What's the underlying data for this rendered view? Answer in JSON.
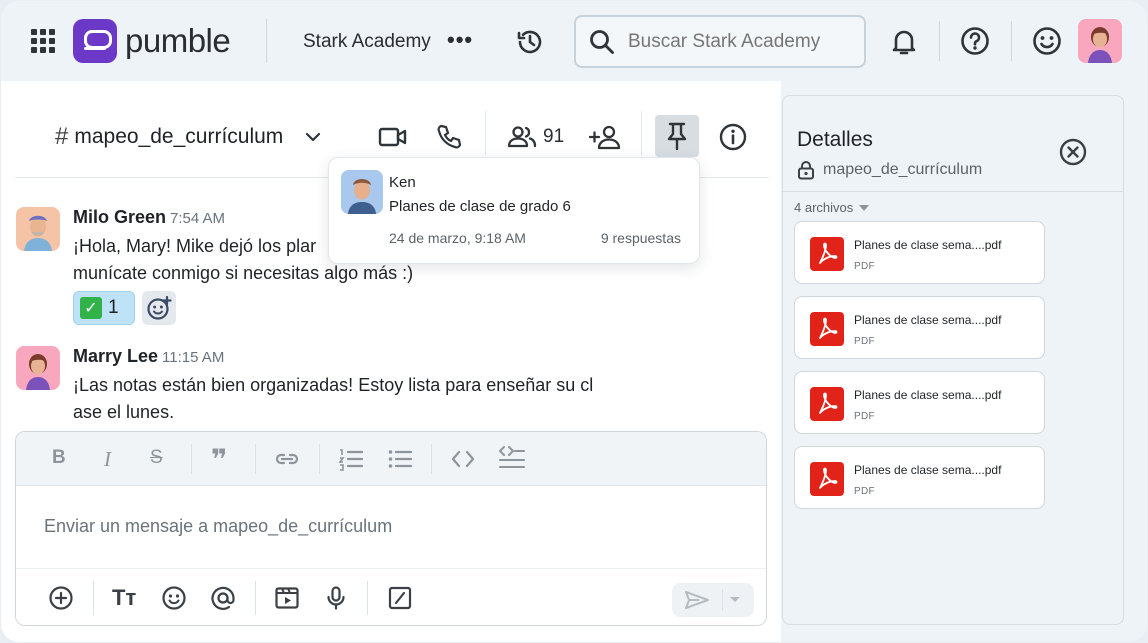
{
  "app": {
    "name": "pumble"
  },
  "workspace": {
    "name": "Stark Academy",
    "more": "•••"
  },
  "search": {
    "placeholder": "Buscar Stark Academy"
  },
  "channel": {
    "name": "mapeo_de_currículum",
    "members_count": "91"
  },
  "messages": [
    {
      "author": "Milo Green",
      "time": "7:54 AM",
      "text": "¡Hola, Mary! Mike dejó los planes de clase de la semana pasada. Comunícate conmigo si necesitas algo más :)",
      "text_visible_line1": "¡Hola, Mary! Mike dejó los plar",
      "text_visible_line2": "munícate conmigo si necesitas algo más :)",
      "reactions": [
        {
          "emoji": "✅",
          "count": "1"
        }
      ]
    },
    {
      "author": "Marry Lee",
      "time": "11:15 AM",
      "text_line1": "¡Las notas están bien organizadas! Estoy lista para enseñar su cl",
      "text_line2": "ase el lunes."
    }
  ],
  "thread_popup": {
    "author": "Ken",
    "text": "Planes de clase de grado 6",
    "date": "24 de marzo, 9:18 AM",
    "replies": "9 respuestas"
  },
  "composer": {
    "placeholder": "Enviar un mensaje a mapeo_de_currículum"
  },
  "details": {
    "title": "Detalles",
    "channel": "mapeo_de_currículum",
    "files_count": "4 archivos",
    "files": [
      {
        "name": "Planes de clase sema....pdf",
        "type": "PDF"
      },
      {
        "name": "Planes de clase sema....pdf",
        "type": "PDF"
      },
      {
        "name": "Planes de clase sema....pdf",
        "type": "PDF"
      },
      {
        "name": "Planes de clase sema....pdf",
        "type": "PDF"
      }
    ]
  },
  "colors": {
    "brand": "#6c38c8",
    "pdf": "#e2231a",
    "reaction_active": "#bfe3f6"
  }
}
